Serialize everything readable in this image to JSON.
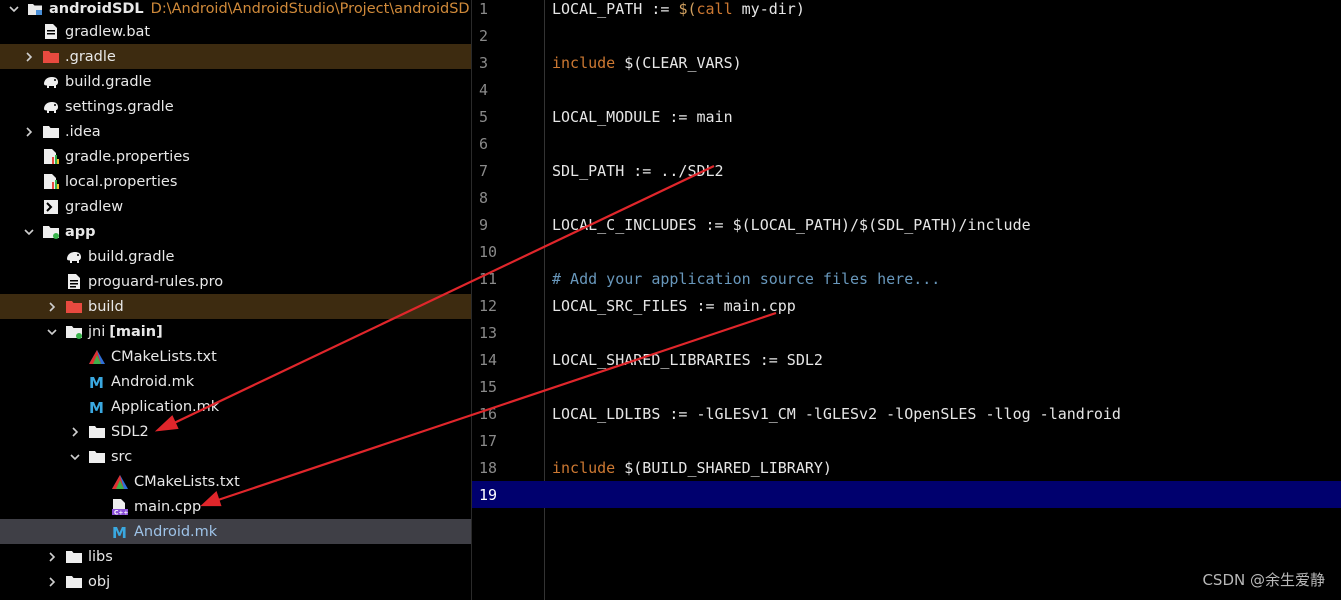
{
  "project": {
    "root": {
      "name": "androidSDL",
      "path": "D:\\Android\\AndroidStudio\\Project\\androidSDL"
    },
    "items": [
      {
        "label": "gradlew.bat",
        "icon": "batch-file-icon",
        "depth": 1,
        "arrow": ""
      },
      {
        "label": ".gradle",
        "icon": "folder-red-icon",
        "depth": 1,
        "arrow": "right",
        "state": "excluded"
      },
      {
        "label": "build.gradle",
        "icon": "gradle-elephant-icon",
        "depth": 1,
        "arrow": ""
      },
      {
        "label": "settings.gradle",
        "icon": "gradle-elephant-icon",
        "depth": 1,
        "arrow": ""
      },
      {
        "label": ".idea",
        "icon": "folder-icon",
        "depth": 1,
        "arrow": "right"
      },
      {
        "label": "gradle.properties",
        "icon": "properties-file-icon",
        "depth": 1,
        "arrow": ""
      },
      {
        "label": "local.properties",
        "icon": "properties-file-icon",
        "depth": 1,
        "arrow": ""
      },
      {
        "label": "gradlew",
        "icon": "terminal-icon",
        "depth": 1,
        "arrow": ""
      },
      {
        "label": "app",
        "icon": "module-folder-icon",
        "depth": 1,
        "arrow": "down",
        "bold": true
      },
      {
        "label": "build.gradle",
        "icon": "gradle-elephant-icon",
        "depth": 2,
        "arrow": ""
      },
      {
        "label": "proguard-rules.pro",
        "icon": "text-file-icon",
        "depth": 2,
        "arrow": ""
      },
      {
        "label": "build",
        "icon": "folder-red-icon",
        "depth": 2,
        "arrow": "right",
        "state": "excluded"
      },
      {
        "label": "jni",
        "suffix": "[main]",
        "icon": "source-folder-icon",
        "depth": 2,
        "arrow": "down"
      },
      {
        "label": "CMakeLists.txt",
        "icon": "cmake-icon",
        "depth": 3,
        "arrow": ""
      },
      {
        "label": "Android.mk",
        "icon": "makefile-icon",
        "depth": 3,
        "arrow": ""
      },
      {
        "label": "Application.mk",
        "icon": "makefile-icon",
        "depth": 3,
        "arrow": ""
      },
      {
        "label": "SDL2",
        "icon": "folder-icon",
        "depth": 3,
        "arrow": "right"
      },
      {
        "label": "src",
        "icon": "folder-icon",
        "depth": 3,
        "arrow": "down"
      },
      {
        "label": "CMakeLists.txt",
        "icon": "cmake-icon",
        "depth": 4,
        "arrow": ""
      },
      {
        "label": "main.cpp",
        "icon": "cpp-file-icon",
        "depth": 4,
        "arrow": ""
      },
      {
        "label": "Android.mk",
        "icon": "makefile-icon",
        "depth": 4,
        "arrow": "",
        "state": "selected"
      },
      {
        "label": "libs",
        "icon": "folder-icon",
        "depth": 2,
        "arrow": "right"
      },
      {
        "label": "obj",
        "icon": "folder-icon",
        "depth": 2,
        "arrow": "right"
      }
    ]
  },
  "editor": {
    "current_line": 19,
    "lines": [
      {
        "n": "1",
        "code": "LOCAL_PATH := $(call my-dir)"
      },
      {
        "n": "2",
        "code": ""
      },
      {
        "n": "3",
        "code": "include $(CLEAR_VARS)"
      },
      {
        "n": "4",
        "code": ""
      },
      {
        "n": "5",
        "code": "LOCAL_MODULE := main"
      },
      {
        "n": "6",
        "code": ""
      },
      {
        "n": "7",
        "code": "SDL_PATH := ../SDL2"
      },
      {
        "n": "8",
        "code": ""
      },
      {
        "n": "9",
        "code": "LOCAL_C_INCLUDES := $(LOCAL_PATH)/$(SDL_PATH)/include"
      },
      {
        "n": "10",
        "code": ""
      },
      {
        "n": "11",
        "code": "# Add your application source files here..."
      },
      {
        "n": "12",
        "code": "LOCAL_SRC_FILES := main.cpp"
      },
      {
        "n": "13",
        "code": ""
      },
      {
        "n": "14",
        "code": "LOCAL_SHARED_LIBRARIES := SDL2"
      },
      {
        "n": "15",
        "code": ""
      },
      {
        "n": "16",
        "code": "LOCAL_LDLIBS := -lGLESv1_CM -lGLESv2 -lOpenSLES -llog -landroid"
      },
      {
        "n": "17",
        "code": ""
      },
      {
        "n": "18",
        "code": "include $(BUILD_SHARED_LIBRARY)"
      },
      {
        "n": "19",
        "code": ""
      }
    ]
  },
  "colors": {
    "excluded_row": "#3d2b10",
    "selected_row": "#3f3f46",
    "current_line": "#00006e",
    "keyword": "#cc7832",
    "comment": "#6897bb",
    "annotation_arrow": "#e0262b"
  },
  "watermark": "CSDN @余生爱静"
}
